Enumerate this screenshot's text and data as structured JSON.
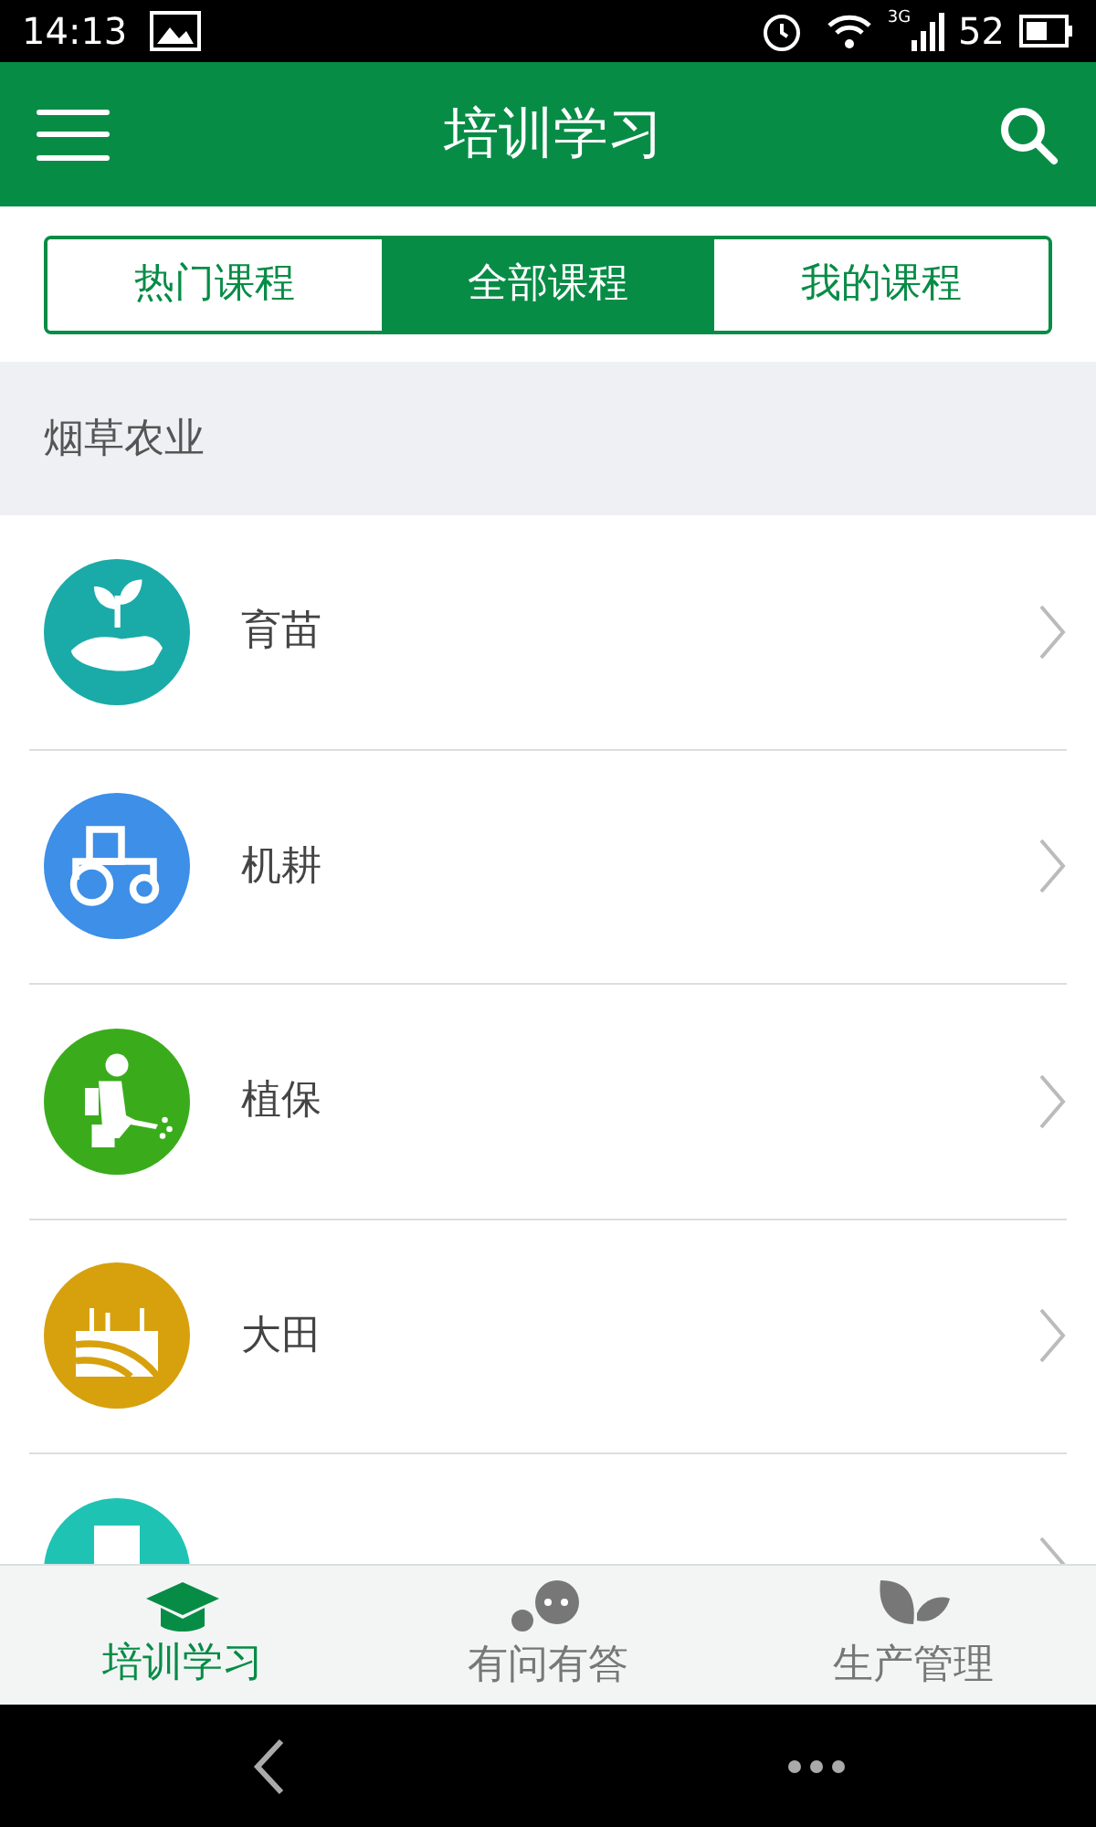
{
  "status_bar": {
    "time": "14:13",
    "network": "3G",
    "battery": "52"
  },
  "header": {
    "title": "培训学习"
  },
  "tabs": [
    {
      "label": "热门课程",
      "selected": false
    },
    {
      "label": "全部课程",
      "selected": true
    },
    {
      "label": "我的课程",
      "selected": false
    }
  ],
  "section": {
    "title": "烟草农业"
  },
  "items": [
    {
      "label": "育苗",
      "kind": "seedling",
      "color": "#1aaba8"
    },
    {
      "label": "机耕",
      "kind": "tractor",
      "color": "#3d8fe8"
    },
    {
      "label": "植保",
      "kind": "sprayer",
      "color": "#3aac1c"
    },
    {
      "label": "大田",
      "kind": "field",
      "color": "#d7a10e"
    },
    {
      "kind": "building",
      "color": "#1fc3b3"
    }
  ],
  "bottom_nav": [
    {
      "label": "培训学习",
      "kind": "cap",
      "selected": true
    },
    {
      "label": "有问有答",
      "kind": "chat",
      "selected": false
    },
    {
      "label": "生产管理",
      "kind": "leaf",
      "selected": false
    }
  ]
}
